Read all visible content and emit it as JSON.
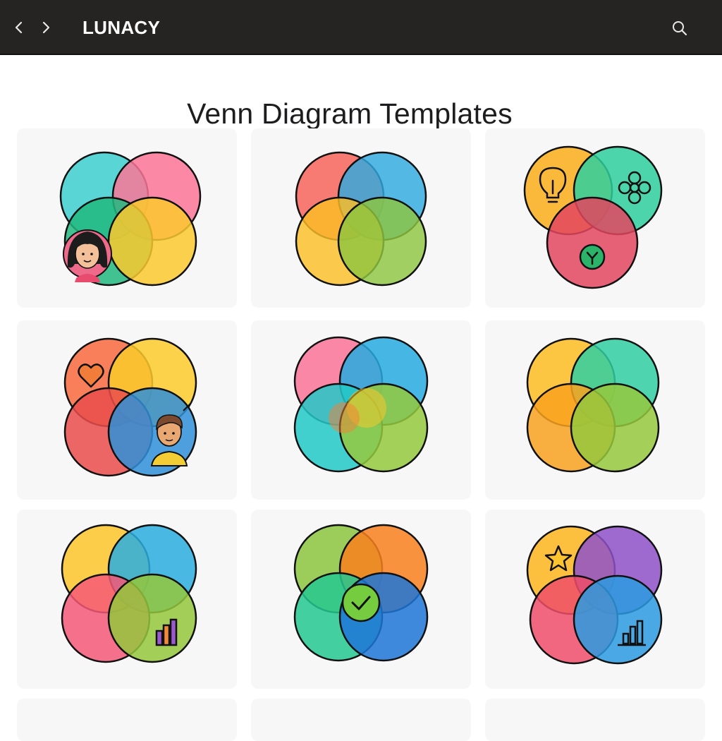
{
  "header": {
    "brand": "LUNACY",
    "back_icon": "chevron-left-icon",
    "forward_icon": "chevron-right-icon",
    "search_icon": "search-icon",
    "background": "#252422"
  },
  "main": {
    "title": "Venn Diagram Templates"
  },
  "templates": [
    {
      "name": "venn-template-1",
      "colors": [
        "#3ecfd0",
        "#fb7598",
        "#22b97f",
        "#fbc92e"
      ],
      "icon": "woman-avatar-icon"
    },
    {
      "name": "venn-template-2",
      "colors": [
        "#f75f54",
        "#2fa9e0",
        "#fbbe25",
        "#8dc63f"
      ],
      "icon": null
    },
    {
      "name": "venn-template-3",
      "colors": [
        "#fbae1b",
        "#2ecf9e",
        "#e3455f"
      ],
      "icon": "lightbulb-icon, flower-icon, check-circle-icon"
    },
    {
      "name": "venn-template-4",
      "colors": [
        "#f86a3e",
        "#fccb2a",
        "#ea4c4c",
        "#2f8fd8"
      ],
      "icon": "heart-icon, man-avatar-icon"
    },
    {
      "name": "venn-template-5",
      "colors": [
        "#fb7398",
        "#27abe1",
        "#22c9c8",
        "#94c93d"
      ],
      "icon": null
    },
    {
      "name": "venn-template-6",
      "colors": [
        "#fdbd22",
        "#30cfa2",
        "#f9a21e",
        "#95c83d"
      ],
      "icon": null
    },
    {
      "name": "venn-template-7",
      "colors": [
        "#fdc52a",
        "#2aaedf",
        "#f55877",
        "#94c73c"
      ],
      "icon": "bar-chart-icon"
    },
    {
      "name": "venn-template-8",
      "colors": [
        "#8cc63f",
        "#f9801d",
        "#24c891",
        "#1f75d8"
      ],
      "icon": "check-circle-icon"
    },
    {
      "name": "venn-template-9",
      "colors": [
        "#fdb51d",
        "#8e51c9",
        "#ef4d6a",
        "#2c9be0"
      ],
      "icon": "star-icon, bar-chart-icon"
    },
    {
      "name": "venn-template-10",
      "colors": [],
      "icon": null
    },
    {
      "name": "venn-template-11",
      "colors": [],
      "icon": null
    },
    {
      "name": "venn-template-12",
      "colors": [],
      "icon": null
    }
  ]
}
